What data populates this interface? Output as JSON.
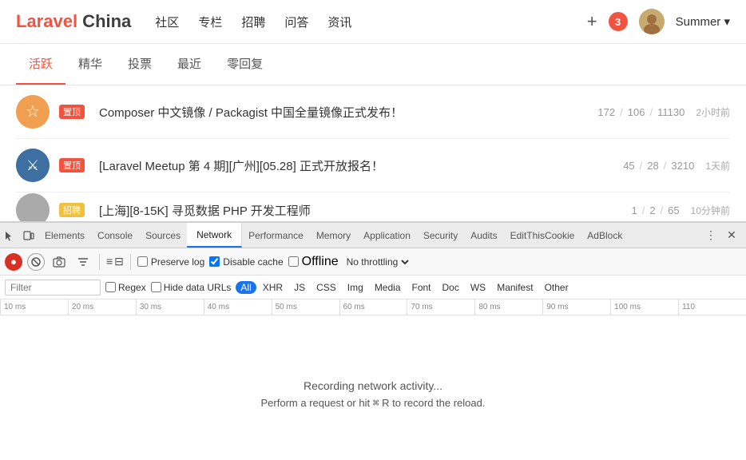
{
  "nav": {
    "logo_part1": "Laravel",
    "logo_part2": " China",
    "links": [
      "社区",
      "专栏",
      "招聘",
      "问答",
      "资讯"
    ],
    "badge_count": "3",
    "user_name": "Summer",
    "user_dropdown": "▾"
  },
  "tabs": {
    "items": [
      "活跃",
      "精华",
      "投票",
      "最近",
      "零回复"
    ],
    "active_index": 0
  },
  "posts": [
    {
      "badge": "置顶",
      "badge_type": "top",
      "title": "Composer 中文镜像 / Packagist 中国全量镜像正式发布！",
      "stat1": "172",
      "stat2": "106",
      "stat3": "11130",
      "time": "2小时前",
      "avatar_color": "#f0a050"
    },
    {
      "badge": "置顶",
      "badge_type": "top",
      "title": "[Laravel Meetup 第 4 期][广州][05.28] 正式开放报名！",
      "stat1": "45",
      "stat2": "28",
      "stat3": "3210",
      "time": "1天前",
      "avatar_color": "#3d6fa0"
    },
    {
      "badge": "招聘",
      "badge_type": "job",
      "title": "[上海][8-15K] 寻觅数据 PHP 开发工程师",
      "stat1": "1",
      "stat2": "2",
      "stat3": "65",
      "time": "10分钟前",
      "avatar_color": "#aaa"
    }
  ],
  "devtools": {
    "tabs": [
      "Elements",
      "Console",
      "Sources",
      "Network",
      "Performance",
      "Memory",
      "Application",
      "Security",
      "Audits",
      "EditThisCookie",
      "AdBlock"
    ],
    "active_tab": "Network",
    "toolbar": {
      "preserve_log_label": "Preserve log",
      "preserve_log_checked": false,
      "disable_cache_label": "Disable cache",
      "disable_cache_checked": true,
      "offline_label": "Offline",
      "throttle_label": "No throttling"
    },
    "filter": {
      "placeholder": "Filter",
      "regex_label": "Regex",
      "hide_data_label": "Hide data URLs",
      "tags": [
        "All",
        "XHR",
        "JS",
        "CSS",
        "Img",
        "Media",
        "Font",
        "Doc",
        "WS",
        "Manifest",
        "Other"
      ],
      "active_tag": "All"
    },
    "timeline": {
      "marks": [
        "10 ms",
        "20 ms",
        "30 ms",
        "40 ms",
        "50 ms",
        "60 ms",
        "70 ms",
        "80 ms",
        "90 ms",
        "100 ms",
        "110"
      ]
    },
    "recording": {
      "line1": "Recording network activity...",
      "line2_prefix": "Perform a request or hit ",
      "kbd": "⌘",
      "line2_suffix": " R to record the reload."
    }
  }
}
